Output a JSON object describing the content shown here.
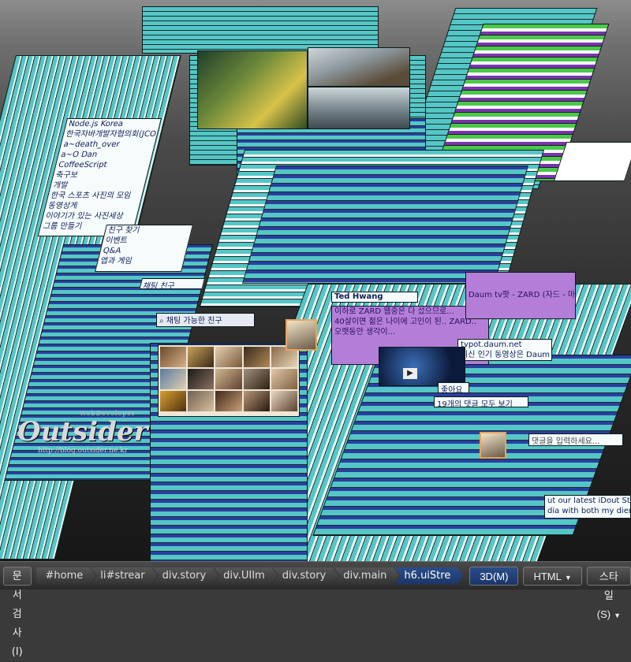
{
  "watermark": {
    "small": "WebDeveloper",
    "name": "Outsider",
    "url": "http://blog.outsider.ne.kr"
  },
  "sidebar": {
    "items": [
      "Node.js Korea",
      "한국자바개발자협의회(JCO)",
      "a~death_over",
      "a~O Dan",
      "CoffeeScript",
      "축구보",
      "개발",
      "한국 스포츠 사진의 모임",
      "동영상게",
      "이야기가 있는 사진세상",
      "그룹 만들기"
    ],
    "lower_items": [
      "친구 찾기",
      "이벤트",
      "Q&A",
      "앱과 게임"
    ],
    "chat_friends": "채팅 친구",
    "chat_search": "채팅 가능한 친구"
  },
  "feed": {
    "author": "Ted Hwang",
    "lines": [
      "이하로 ZARD 웹중은 다 섰으므로...",
      "40살이면 젊은 나이에 고인이 된.. ZARD..",
      "오랫동안 생각이..."
    ],
    "link_title": "Daum tv팟 - ZARD (자드 - 마..",
    "link_domain": "tvpot.daum.net",
    "link_desc": "최신 인기 동영상은 Daum tv팟에서!",
    "like_label": "좋아요",
    "comments_label": "19개의 댓글 모두 보기",
    "comment_placeholder": "댓글을 입력하세요...",
    "english_text": "ut our latest iDout Star Christine K",
    "english_text2": "dia with both my dien"
  },
  "devtools": {
    "inspect_label": "문서 검사(I)",
    "breadcrumbs": [
      "#home",
      "li#strear",
      "div.story",
      "div.UIIm",
      "div.story",
      "div.main",
      "h6.uiStre"
    ],
    "active_crumb": 6,
    "modes": [
      "3D(M)",
      "HTML",
      "스타일(S)"
    ],
    "active_mode": 0
  },
  "colors": {
    "teal": "#55c6c6",
    "deep_blue": "#2a3fa0",
    "green": "#49c84a",
    "purple": "#7a34b0",
    "orange": "#e6a561",
    "red": "#d8282a"
  }
}
